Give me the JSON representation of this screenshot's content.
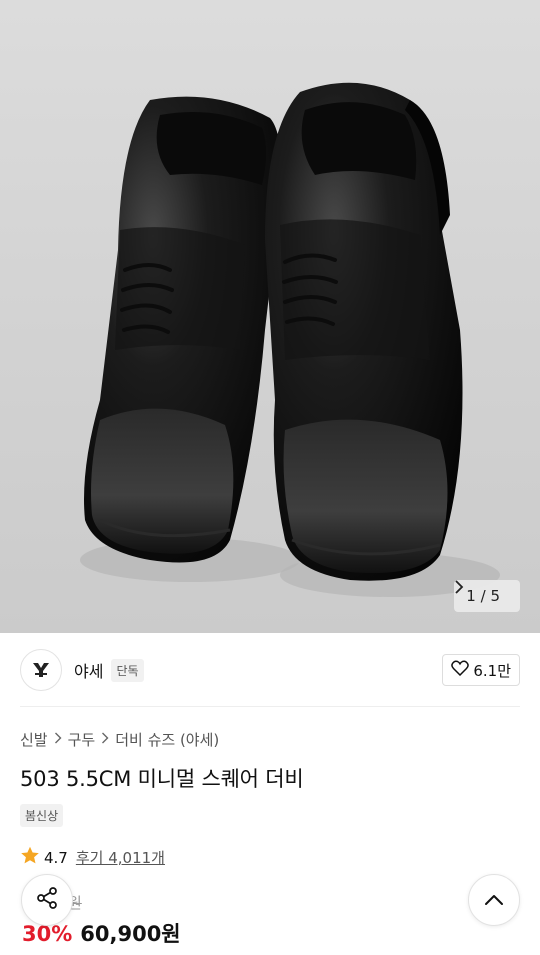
{
  "gallery": {
    "current": "1",
    "separator": "/",
    "total": "5",
    "next_icon": "chevron-right-icon"
  },
  "brand": {
    "logo_icon": "brand-logo-icon",
    "name": "야세",
    "badge": "단독",
    "like_icon": "heart-outline-icon",
    "like_count": "6.1만"
  },
  "breadcrumb": {
    "items": [
      "신발",
      "구두",
      "더비 슈즈 (야세)"
    ],
    "separator_icon": "chevron-right-icon"
  },
  "product": {
    "title": "503 5.5CM 미니멀 스퀘어 더비",
    "tag": "봄신상",
    "rating_icon": "star-icon",
    "rating": "4.7",
    "review_label": "후기 4,011개",
    "original_price": "원",
    "discount": "30%",
    "price": "60,900원"
  },
  "floating": {
    "share_icon": "share-icon",
    "top_icon": "chevron-up-icon"
  },
  "colors": {
    "discount": "#e21d2c",
    "star": "#f5a623",
    "hero_bg": "#d4d4d4"
  }
}
